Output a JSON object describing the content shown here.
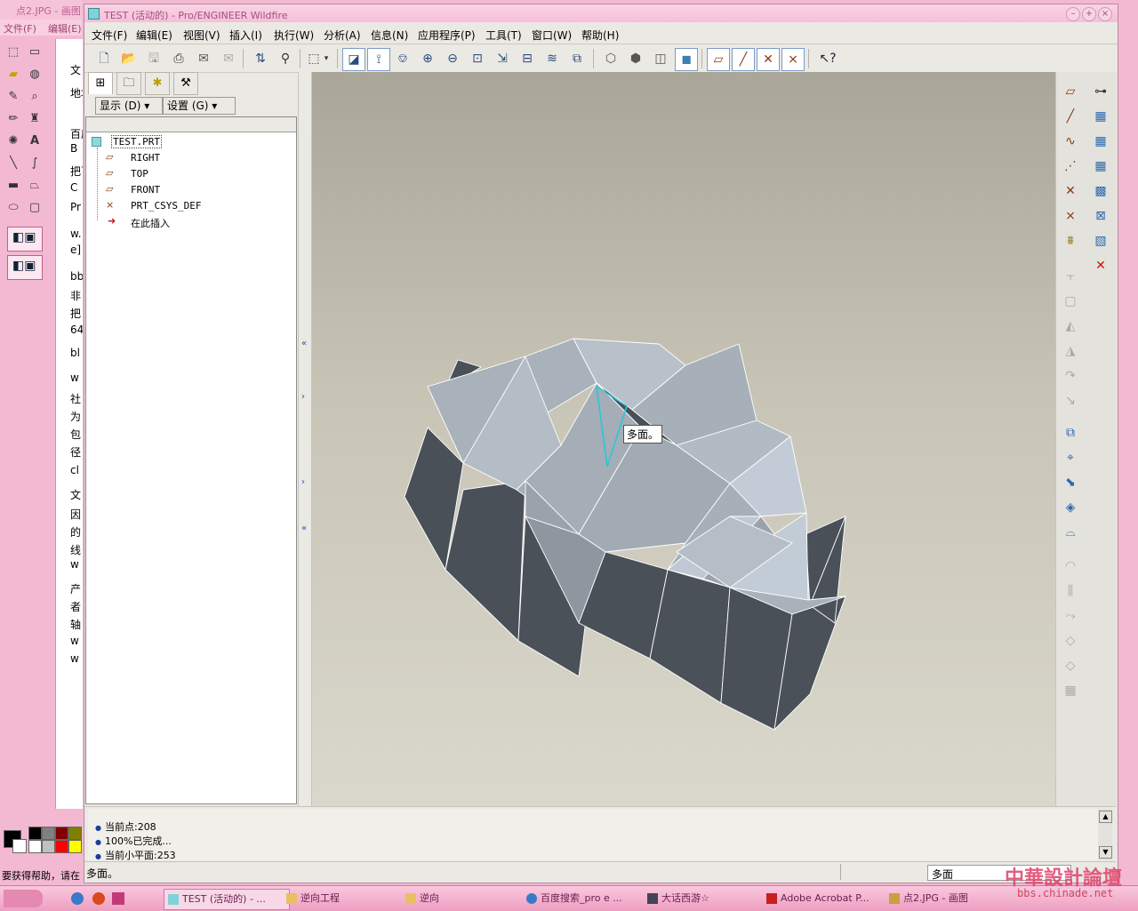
{
  "background_app": {
    "title": "点2.JPG - 画图",
    "menu": [
      "文件(F)",
      "编辑(E)"
    ],
    "status": "要获得帮助，请在",
    "browser_fragments": [
      "文",
      "地址",
      "百度",
      "B",
      "把百",
      "C",
      "Pr",
      "w.",
      "e]",
      "bb",
      "非",
      "把",
      "64",
      "bl",
      "w",
      "社",
      "为",
      "包",
      "径",
      "cl",
      "文",
      "因",
      "的",
      "线",
      "w",
      "产",
      "者",
      "轴",
      "w",
      "w"
    ],
    "palette_colors": [
      "#000000",
      "#808080",
      "#800000",
      "#808000",
      "#ffffff",
      "#c0c0c0",
      "#ff0000",
      "#ffff00"
    ]
  },
  "window": {
    "title": "TEST (活动的) - Pro/ENGINEER Wildfire",
    "controls": [
      "–",
      "+",
      "×"
    ]
  },
  "menubar": [
    "文件(F)",
    "编辑(E)",
    "视图(V)",
    "插入(I)",
    "执行(W)",
    "分析(A)",
    "信息(N)",
    "应用程序(P)",
    "工具(T)",
    "窗口(W)",
    "帮助(H)"
  ],
  "toolbar_icons": [
    "new-icon",
    "open-icon",
    "save-icon",
    "print-icon",
    "email-icon",
    "email-alt-icon",
    "regenerate-icon",
    "find-icon",
    "select-box-icon",
    "dropdown-icon",
    "repaint-icon",
    "spin-center-icon",
    "orient-icon",
    "zoom-in-icon",
    "zoom-out-icon",
    "refit-icon",
    "reorient-icon",
    "saved-view-icon",
    "layers-icon",
    "view-manager-icon",
    "wireframe-icon",
    "hidden-line-icon",
    "no-hidden-icon",
    "shading-icon",
    "datum-planes-icon",
    "datum-axes-icon",
    "datum-points-icon",
    "csys-icon",
    "context-help-icon"
  ],
  "nav": {
    "tabs": [
      "model-tree-tab",
      "folder-browser-tab",
      "favorites-tab",
      "connections-tab"
    ],
    "show_button": "显示 (D)",
    "settings_button": "设置 (G)"
  },
  "model_tree": {
    "root": "TEST.PRT",
    "items": [
      {
        "label": "RIGHT",
        "icon": "datum-plane-icon"
      },
      {
        "label": "TOP",
        "icon": "datum-plane-icon"
      },
      {
        "label": "FRONT",
        "icon": "datum-plane-icon"
      },
      {
        "label": "PRT_CSYS_DEF",
        "icon": "csys-icon"
      },
      {
        "label": "在此插入",
        "icon": "insert-here-arrow-icon"
      }
    ]
  },
  "graphics": {
    "tooltip": "多面。",
    "model_colors": {
      "light": "#a5adb6",
      "lighter": "#c2ccd6",
      "dark": "#4a5058",
      "edge": "#ffffff",
      "highlight": "#28c8d8"
    }
  },
  "right_toolbar_icons": [
    "datum-plane-tool-icon",
    "datum-axis-tool-icon",
    "datum-curve-tool-icon",
    "sketched-curve-icon",
    "datum-point-icon",
    "csys-tool-icon",
    "analysis-feature-icon",
    "hole-icon",
    "shell-icon",
    "rib-icon",
    "draft-icon",
    "round-icon",
    "chamfer-icon",
    "copy-icon",
    "mirror-icon",
    "trim-icon",
    "extend-icon",
    "offset-icon",
    "thicken-icon",
    "solidify-icon",
    "merge-icon",
    "intersect-icon",
    "project-icon",
    "pattern-icon",
    "measure-icon",
    "facet-tool-icon",
    "close-icon"
  ],
  "messages": [
    "当前点:208",
    "100%已完成...",
    "当前小平面:253"
  ],
  "status": {
    "text": "多面。",
    "filter": "多面"
  },
  "taskbar": [
    {
      "label": "TEST (活动的) - ...",
      "active": true
    },
    {
      "label": "逆向工程",
      "active": false
    },
    {
      "label": "逆向",
      "active": false
    },
    {
      "label": "百度搜索_pro e ...",
      "active": false
    },
    {
      "label": "大话西游☆",
      "active": false
    },
    {
      "label": "Adobe Acrobat P...",
      "active": false
    },
    {
      "label": "点2.JPG - 画图",
      "active": false
    }
  ],
  "watermark": {
    "title": "中華設計論壇",
    "url": "bbs.chinade.net"
  }
}
